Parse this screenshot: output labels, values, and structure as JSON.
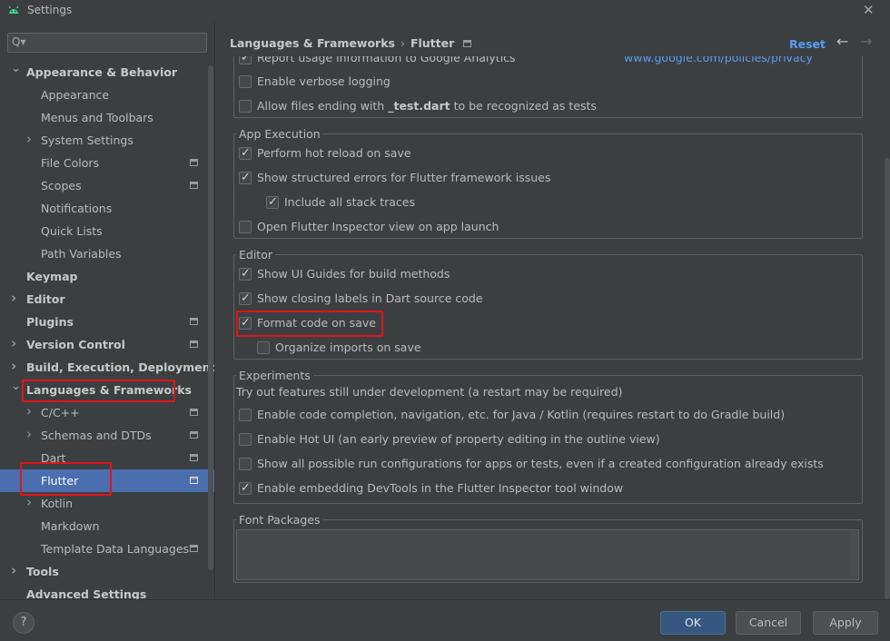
{
  "window": {
    "title": "Settings",
    "close_glyph": "✕"
  },
  "sidebar": {
    "search_placeholder": "",
    "search_icon": "Q▾",
    "items": [
      {
        "label": "Appearance & Behavior",
        "bold": true,
        "chevron": "down"
      },
      {
        "label": "Appearance"
      },
      {
        "label": "Menus and Toolbars"
      },
      {
        "label": "System Settings",
        "chevron": "right"
      },
      {
        "label": "File Colors",
        "project_icon": true
      },
      {
        "label": "Scopes",
        "project_icon": true
      },
      {
        "label": "Notifications"
      },
      {
        "label": "Quick Lists"
      },
      {
        "label": "Path Variables"
      },
      {
        "label": "Keymap",
        "bold": true
      },
      {
        "label": "Editor",
        "bold": true,
        "chevron": "right"
      },
      {
        "label": "Plugins",
        "bold": true,
        "project_icon": true
      },
      {
        "label": "Version Control",
        "bold": true,
        "chevron": "right",
        "project_icon": true
      },
      {
        "label": "Build, Execution, Deployment",
        "bold": true,
        "chevron": "right"
      },
      {
        "label": "Languages & Frameworks",
        "bold": true,
        "chevron": "down"
      },
      {
        "label": "C/C++",
        "chevron": "right",
        "project_icon": true
      },
      {
        "label": "Schemas and DTDs",
        "chevron": "right",
        "project_icon": true
      },
      {
        "label": "Dart",
        "project_icon": true
      },
      {
        "label": "Flutter",
        "project_icon": true,
        "selected": true
      },
      {
        "label": "Kotlin",
        "chevron": "right"
      },
      {
        "label": "Markdown"
      },
      {
        "label": "Template Data Languages",
        "project_icon": true
      },
      {
        "label": "Tools",
        "bold": true,
        "chevron": "right"
      },
      {
        "label": "Advanced Settings",
        "bold": true
      }
    ]
  },
  "header": {
    "breadcrumb_parent": "Languages & Frameworks",
    "breadcrumb_separator": "›",
    "breadcrumb_current": "Flutter",
    "reset_label": "Reset",
    "back_glyph": "←",
    "forward_glyph": "→"
  },
  "top_group": {
    "analytics_label": "Report usage information to Google Analytics",
    "analytics_checked": true,
    "privacy_link": "www.google.com/policies/privacy",
    "verbose_label": "Enable verbose logging",
    "verbose_checked": false,
    "test_files_prefix": "Allow files ending with ",
    "test_files_bold": "_test.dart",
    "test_files_suffix": " to be recognized as tests",
    "test_files_checked": false
  },
  "app_execution": {
    "title": "App Execution",
    "hot_reload": {
      "label": "Perform hot reload on save",
      "checked": true
    },
    "structured_errors": {
      "label": "Show structured errors for Flutter framework issues",
      "checked": true
    },
    "stack_traces": {
      "label": "Include all stack traces",
      "checked": true
    },
    "inspector": {
      "label": "Open Flutter Inspector view on app launch",
      "checked": false
    }
  },
  "editor": {
    "title": "Editor",
    "ui_guides": {
      "label": "Show UI Guides for build methods",
      "checked": true
    },
    "closing_labels": {
      "label": "Show closing labels in Dart source code",
      "checked": true
    },
    "format_on_save": {
      "label": "Format code on save",
      "checked": true
    },
    "organize_imports": {
      "label": "Organize imports on save",
      "checked": false
    }
  },
  "experiments": {
    "title": "Experiments",
    "description": "Try out features still under development (a restart may be required)",
    "code_completion": {
      "label": "Enable code completion, navigation, etc. for Java / Kotlin (requires restart to do Gradle build)",
      "checked": false
    },
    "hot_ui": {
      "label": "Enable Hot UI (an early preview of property editing in the outline view)",
      "checked": false
    },
    "run_configs": {
      "label": "Show all possible run configurations for apps or tests, even if a created configuration already exists",
      "checked": false
    },
    "devtools": {
      "label": "Enable embedding DevTools in the Flutter Inspector tool window",
      "checked": true
    }
  },
  "font_packages": {
    "title": "Font Packages"
  },
  "footer": {
    "help_glyph": "?",
    "ok_label": "OK",
    "cancel_label": "Cancel",
    "apply_label": "Apply"
  },
  "colors": {
    "selection": "#4b6eaf",
    "link": "#589df6",
    "highlight_box": "#e0141b",
    "primary_button": "#365880"
  }
}
